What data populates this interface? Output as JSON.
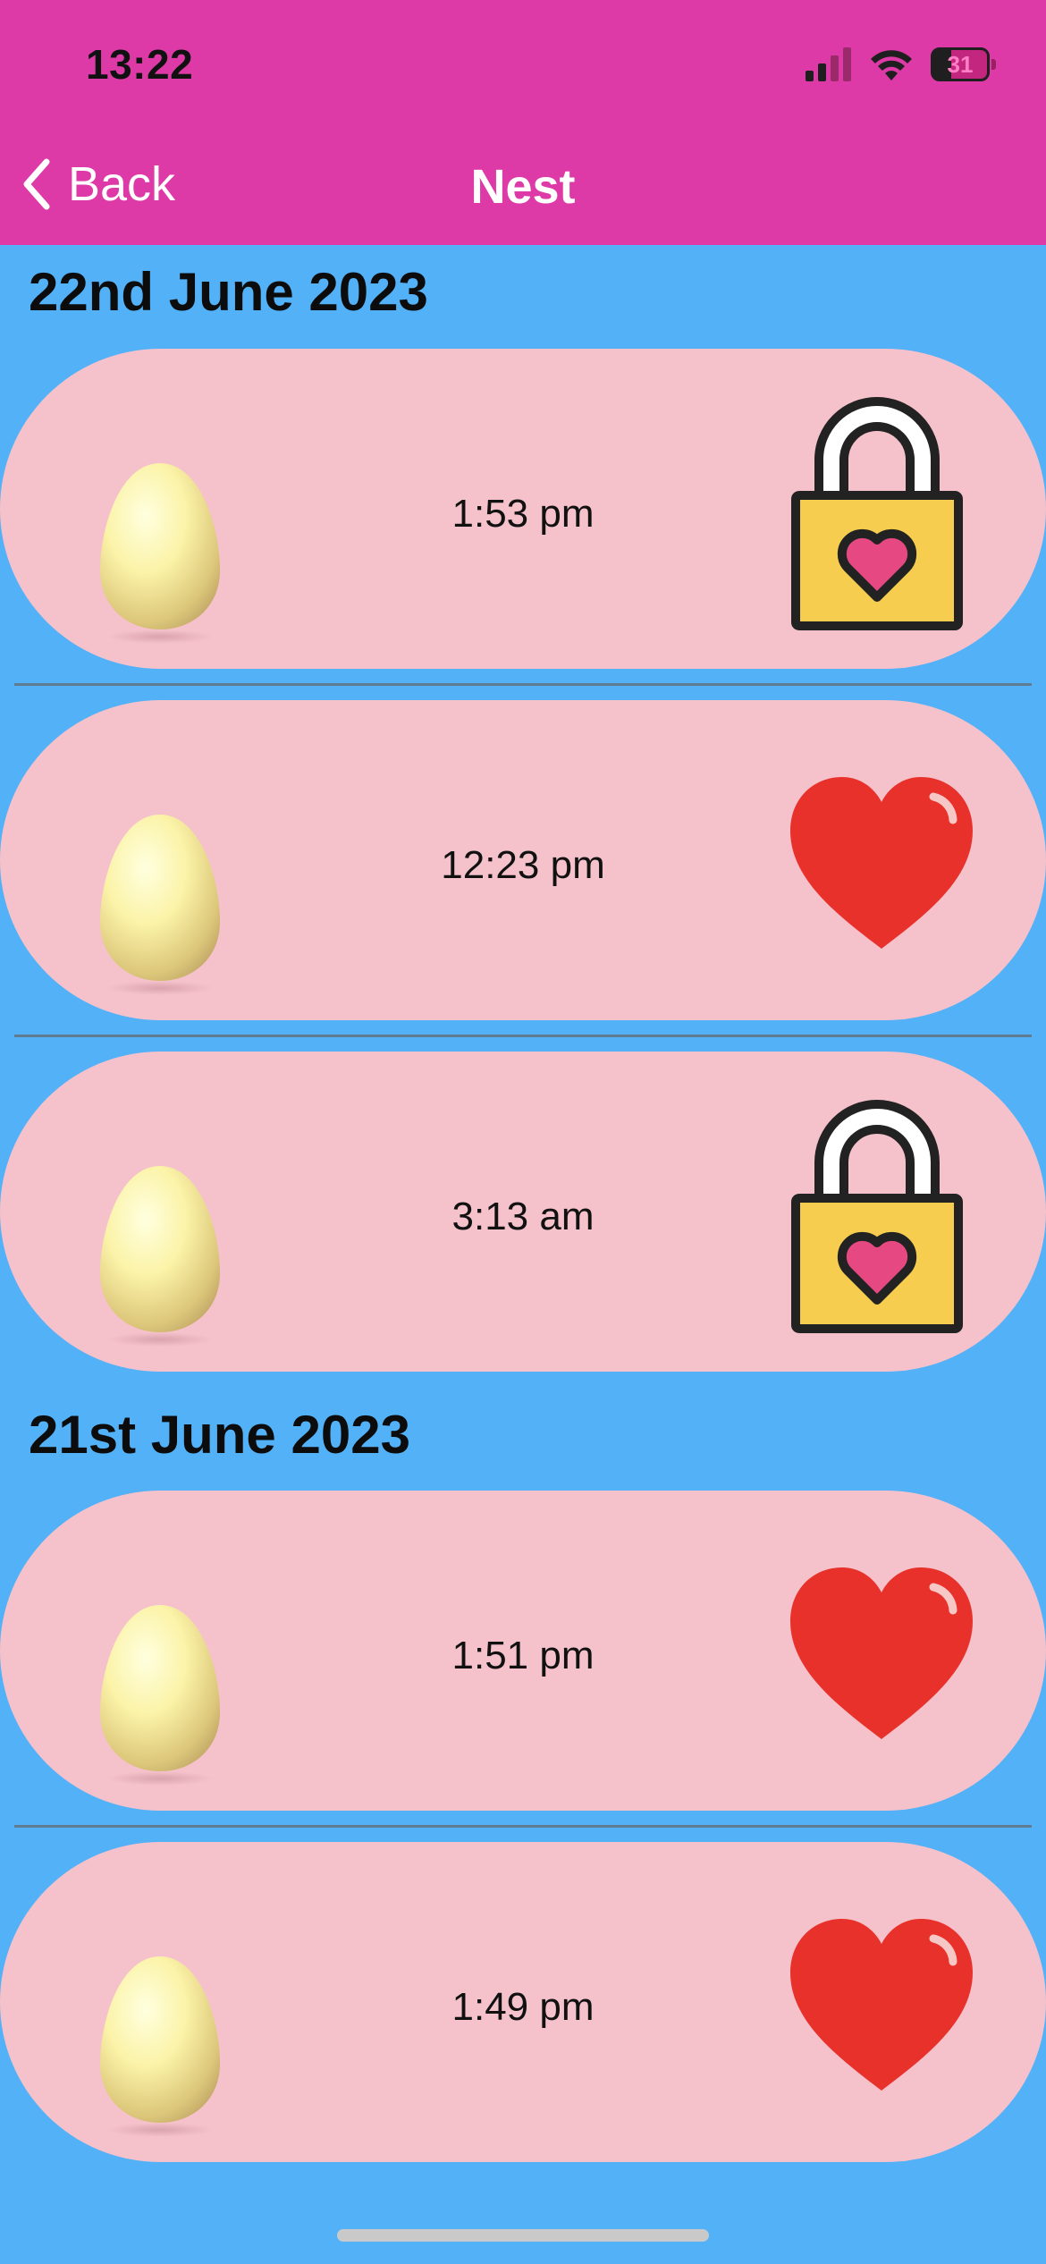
{
  "status_bar": {
    "time": "13:22",
    "battery": "31"
  },
  "nav": {
    "back_label": "Back",
    "title": "Nest"
  },
  "sections": [
    {
      "date": "22nd June 2023",
      "entries": [
        {
          "time": "1:53 pm",
          "status_icon": "padlock-heart-icon"
        },
        {
          "time": "12:23 pm",
          "status_icon": "heart-icon"
        },
        {
          "time": "3:13 am",
          "status_icon": "padlock-heart-icon"
        }
      ]
    },
    {
      "date": "21st June 2023",
      "entries": [
        {
          "time": "1:51 pm",
          "status_icon": "heart-icon"
        },
        {
          "time": "1:49 pm",
          "status_icon": "heart-icon"
        }
      ]
    }
  ],
  "colors": {
    "top_bar": "#de3aa7",
    "background": "#53b1f7",
    "row": "#f5c2cb",
    "heart": "#e8312b",
    "padlock_body": "#f7cd4f",
    "padlock_heart": "#e64982"
  }
}
